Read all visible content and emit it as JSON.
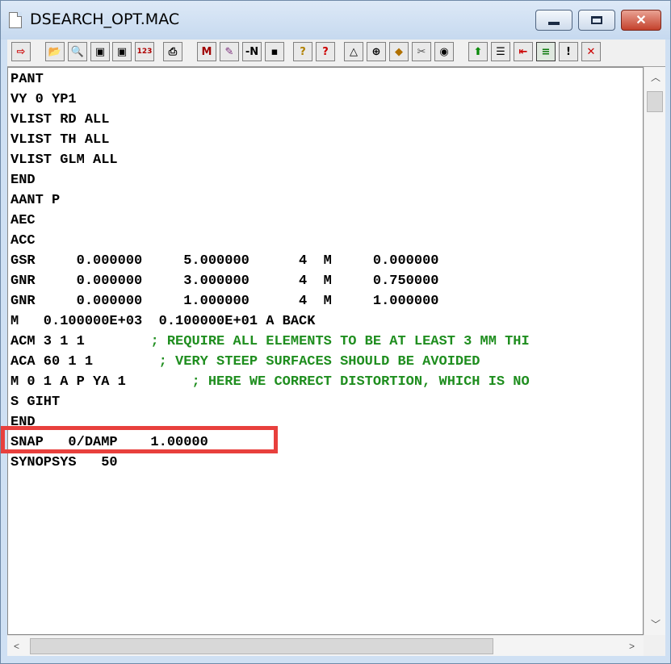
{
  "window": {
    "title": "DSEARCH_OPT.MAC"
  },
  "toolbar": {
    "buttons": [
      {
        "name": "exit-icon",
        "glyph": "⇨",
        "color": "#cc0000"
      },
      {
        "name": "open-folder-icon",
        "glyph": "📂",
        "color": "#d08a00"
      },
      {
        "name": "find-icon",
        "glyph": "🔍",
        "color": "#2a5fb0"
      },
      {
        "name": "save-icon",
        "glyph": "▣",
        "color": "#000000"
      },
      {
        "name": "save-as-icon",
        "glyph": "▣",
        "color": "#000000"
      },
      {
        "name": "line-number-icon",
        "glyph": "123",
        "color": "#b00000"
      },
      {
        "name": "print-icon",
        "glyph": "⎙",
        "color": "#000000"
      },
      {
        "name": "macro-m-icon",
        "glyph": "M",
        "color": "#a00000"
      },
      {
        "name": "macro-edit-icon",
        "glyph": "✎",
        "color": "#7a2a7a"
      },
      {
        "name": "n-minus-icon",
        "glyph": "-N",
        "color": "#000000"
      },
      {
        "name": "insert-icon",
        "glyph": "▪",
        "color": "#000000"
      },
      {
        "name": "help-icon",
        "glyph": "?",
        "color": "#b08000"
      },
      {
        "name": "context-help-icon",
        "glyph": "?",
        "color": "#cc0000"
      },
      {
        "name": "triangle-icon",
        "glyph": "△",
        "color": "#000000"
      },
      {
        "name": "target-icon",
        "glyph": "⊕",
        "color": "#000000"
      },
      {
        "name": "box-icon",
        "glyph": "◆",
        "color": "#b07000"
      },
      {
        "name": "wrench-icon",
        "glyph": "✂",
        "color": "#555555"
      },
      {
        "name": "eye-icon",
        "glyph": "◉",
        "color": "#000000"
      },
      {
        "name": "up-arrow-icon",
        "glyph": "⬆",
        "color": "#0a8a0a"
      },
      {
        "name": "indent-icon",
        "glyph": "☰",
        "color": "#000000"
      },
      {
        "name": "outdent-icon",
        "glyph": "⇤",
        "color": "#cc0000"
      },
      {
        "name": "equal-lines-icon",
        "glyph": "≡",
        "color": "#0a7a0a"
      },
      {
        "name": "exclamation-icon",
        "glyph": "!",
        "color": "#000000"
      },
      {
        "name": "cancel-x-icon",
        "glyph": "✕",
        "color": "#cc0000"
      }
    ]
  },
  "editor": {
    "lines": [
      {
        "code": "PANT",
        "comment": ""
      },
      {
        "code": "VY 0 YP1",
        "comment": ""
      },
      {
        "code": "VLIST RD ALL",
        "comment": ""
      },
      {
        "code": "VLIST TH ALL",
        "comment": ""
      },
      {
        "code": "VLIST GLM ALL",
        "comment": ""
      },
      {
        "code": "END",
        "comment": ""
      },
      {
        "code": "AANT P",
        "comment": ""
      },
      {
        "code": "AEC",
        "comment": ""
      },
      {
        "code": "ACC",
        "comment": ""
      },
      {
        "code": "GSR     0.000000     5.000000      4  M     0.000000",
        "comment": ""
      },
      {
        "code": "GNR     0.000000     3.000000      4  M     0.750000",
        "comment": ""
      },
      {
        "code": "GNR     0.000000     1.000000      4  M     1.000000",
        "comment": ""
      },
      {
        "code": "M   0.100000E+03  0.100000E+01 A BACK",
        "comment": ""
      },
      {
        "code": "ACM 3 1 1        ",
        "comment": "; REQUIRE ALL ELEMENTS TO BE AT LEAST 3 MM THI"
      },
      {
        "code": "ACA 60 1 1        ",
        "comment": "; VERY STEEP SURFACES SHOULD BE AVOIDED"
      },
      {
        "code": "M 0 1 A P YA 1        ",
        "comment": "; HERE WE CORRECT DISTORTION, WHICH IS NO"
      },
      {
        "code": "S GIHT",
        "comment": ""
      },
      {
        "code": "END",
        "comment": ""
      },
      {
        "code": "SNAP   0/DAMP    1.00000",
        "comment": ""
      },
      {
        "code": "SYNOPSYS   50",
        "comment": ""
      }
    ]
  }
}
